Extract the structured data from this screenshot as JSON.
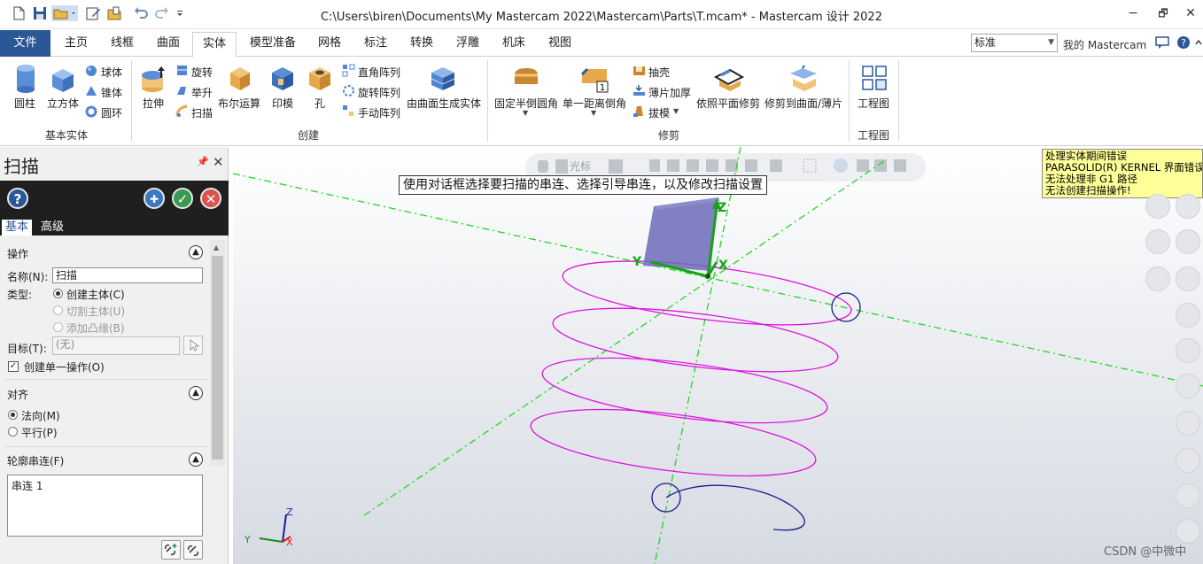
{
  "title_bar": {
    "title": "C:\\Users\\biren\\Documents\\My Mastercam 2022\\Mastercam\\Parts\\T.mcam* - Mastercam 设计 2022",
    "minimize": "−",
    "restore": "🗗",
    "close": "✕"
  },
  "ribbon_tabs": [
    "文件",
    "主页",
    "线框",
    "曲面",
    "实体",
    "模型准备",
    "网格",
    "标注",
    "转换",
    "浮雕",
    "机床",
    "视图"
  ],
  "style_select": {
    "value": "标准"
  },
  "my_mastercam": "我的 Mastercam",
  "ribbon": {
    "basic_solids": {
      "label": "基本实体",
      "cylinder": "圆柱",
      "cube": "立方体",
      "sphere": "球体",
      "cone": "锥体",
      "torus": "圆环"
    },
    "create": {
      "label": "创建",
      "extrude": "拉伸",
      "revolve": "旋转",
      "loft": "举升",
      "sweep": "扫描",
      "boolean": "布尔运算",
      "imprint": "印模",
      "hole": "孔",
      "rect_array": "直角阵列",
      "rot_array": "旋转阵列",
      "manual_array": "手动阵列",
      "from_surfaces": "由曲面生成实体"
    },
    "modify": {
      "label": "修剪",
      "const_fillet": "固定半倒圆角",
      "single_chamfer": "单一距离倒角",
      "shell": "抽壳",
      "thicken": "薄片加厚",
      "draft": "拔模",
      "trim_plane": "依照平面修剪",
      "trim_surface": "修剪到曲面/薄片"
    },
    "drawing": {
      "label": "工程图",
      "drawing": "工程图"
    }
  },
  "panel": {
    "title": "扫描",
    "tabs": [
      "基本",
      "高级"
    ],
    "operation": {
      "header": "操作",
      "name_label": "名称(N):",
      "name_value": "扫描",
      "type_label": "类型:",
      "types": [
        "创建主体(C)",
        "切割主体(U)",
        "添加凸缘(B)"
      ],
      "target_label": "目标(T):",
      "target_value": "(无)",
      "single_op": "创建单一操作(O)"
    },
    "align": {
      "header": "对齐",
      "options": [
        "法向(M)",
        "平行(P)"
      ]
    },
    "profile": {
      "header": "轮廓串连(F)",
      "chain": "串连 1"
    }
  },
  "viewport": {
    "hint": "使用对话框选择要扫描的串连、选择引导串连，以及修改扫描设置",
    "toolbar_label": "光标",
    "errors": [
      "处理实体期间错误",
      "PARASOLID(R) KERNEL 界面错误:",
      "无法处理非 G1 路径",
      "无法创建扫描操作!"
    ],
    "axis_labels": {
      "x": "X",
      "y": "Y",
      "z": "Z"
    },
    "watermark": "CSDN @中微中"
  },
  "colors": {
    "accent": "#2b5797",
    "helix": "#e012e0",
    "axis": "#1fd81f",
    "circle": "#1a1a8c",
    "cube": "#6b6bb8"
  }
}
